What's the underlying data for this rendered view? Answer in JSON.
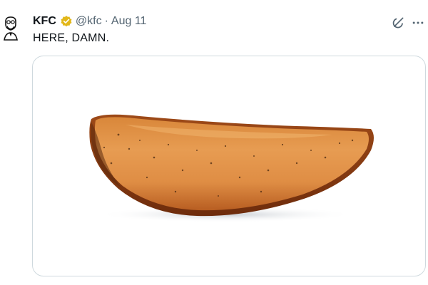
{
  "tweet": {
    "author_name": "KFC",
    "handle": "@kfc",
    "separator": "·",
    "date": "Aug 11",
    "text": "HERE, DAMN."
  },
  "icons": {
    "avatar": "colonel-sanders-logo",
    "verified": "gold-verified-badge-icon",
    "grok": "grok-icon",
    "more": "more-horizontal-icon"
  },
  "colors": {
    "verified_gold": "#e2b719",
    "secondary_text": "#536471",
    "primary_text": "#0f1419",
    "border": "#cfd9de"
  },
  "media": {
    "subject": "potato-wedge-photo"
  }
}
